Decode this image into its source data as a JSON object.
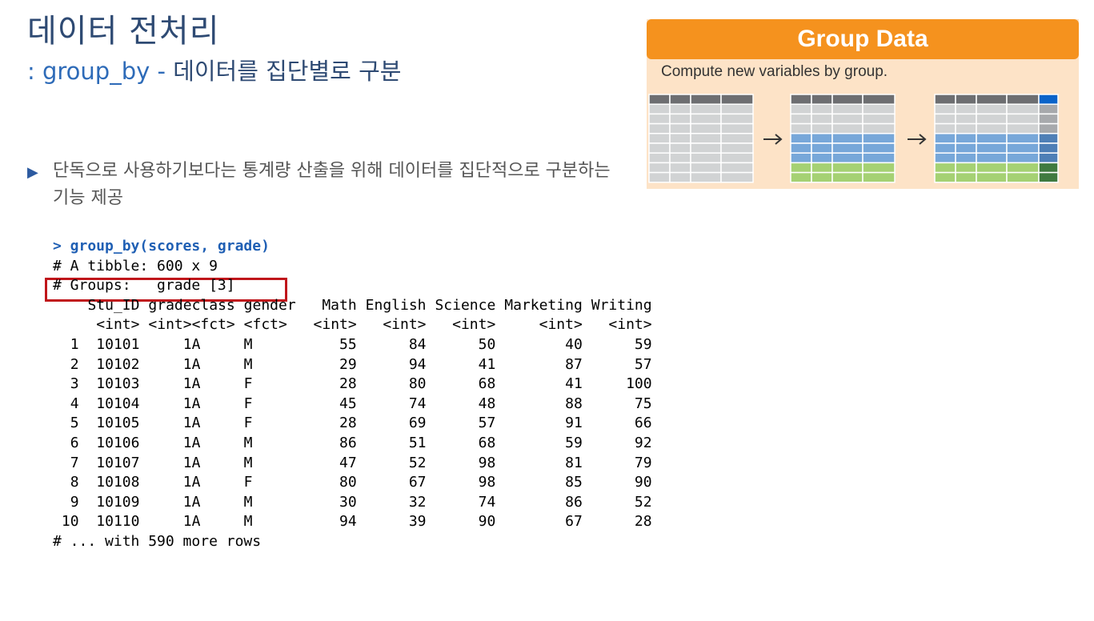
{
  "slide": {
    "title": "데이터 전처리",
    "subtitle_fn": ": group_by - ",
    "subtitle_desc": "데이터를 집단별로 구분",
    "bullet_text": "단독으로 사용하기보다는 통계량 산출을 위해 데이터를 집단적으로 구분하는 기능 제공"
  },
  "graphic": {
    "banner": "Group Data",
    "caption": "Compute new variables by group."
  },
  "console": {
    "command": "> group_by(scores, grade)",
    "tibble_line": "# A tibble: 600 x 9",
    "groups_line": "# Groups:   grade [3]",
    "footer": "# ... with 590 more rows",
    "columns": [
      "Stu_ID",
      "grade",
      "class",
      "gender",
      "Math",
      "English",
      "Science",
      "Marketing",
      "Writing"
    ],
    "types": [
      "<int>",
      "<int>",
      "<fct>",
      "<fct>",
      "<int>",
      "<int>",
      "<int>",
      "<int>",
      "<int>"
    ],
    "rows": [
      [
        "1",
        "10101",
        "1",
        "A",
        "M",
        "55",
        "84",
        "50",
        "40",
        "59"
      ],
      [
        "2",
        "10102",
        "1",
        "A",
        "M",
        "29",
        "94",
        "41",
        "87",
        "57"
      ],
      [
        "3",
        "10103",
        "1",
        "A",
        "F",
        "28",
        "80",
        "68",
        "41",
        "100"
      ],
      [
        "4",
        "10104",
        "1",
        "A",
        "F",
        "45",
        "74",
        "48",
        "88",
        "75"
      ],
      [
        "5",
        "10105",
        "1",
        "A",
        "F",
        "28",
        "69",
        "57",
        "91",
        "66"
      ],
      [
        "6",
        "10106",
        "1",
        "A",
        "M",
        "86",
        "51",
        "68",
        "59",
        "92"
      ],
      [
        "7",
        "10107",
        "1",
        "A",
        "M",
        "47",
        "52",
        "98",
        "81",
        "79"
      ],
      [
        "8",
        "10108",
        "1",
        "A",
        "F",
        "80",
        "67",
        "98",
        "85",
        "90"
      ],
      [
        "9",
        "10109",
        "1",
        "A",
        "M",
        "30",
        "32",
        "74",
        "86",
        "52"
      ],
      [
        "10",
        "10110",
        "1",
        "A",
        "M",
        "94",
        "39",
        "90",
        "67",
        "28"
      ]
    ]
  },
  "colors": {
    "banner": "#f5921e",
    "background": "#fde3c7",
    "header_gray": "#6d6e71",
    "cell_gray": "#d1d3d4",
    "blue": "#77a7d9",
    "green": "#a5d173",
    "highlight": "#c0161b"
  }
}
